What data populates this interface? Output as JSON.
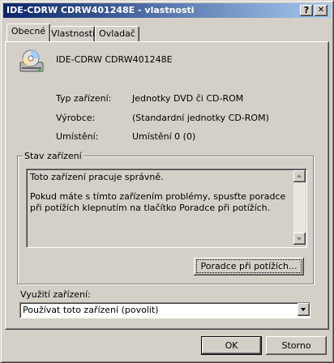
{
  "window": {
    "title": "IDE-CDRW CDRW401248E - vlastnosti",
    "help_label": "?",
    "close_label": "✕"
  },
  "tabs": [
    {
      "label": "Obecné",
      "active": true
    },
    {
      "label": "Vlastnosti",
      "active": false
    },
    {
      "label": "Ovladač",
      "active": false
    }
  ],
  "device": {
    "name": "IDE-CDRW CDRW401248E",
    "icon": "cd-drive-icon"
  },
  "properties": [
    {
      "label": "Typ zařízení:",
      "value": "Jednotky DVD či CD-ROM"
    },
    {
      "label": "Výrobce:",
      "value": "(Standardní jednotky CD-ROM)"
    },
    {
      "label": "Umístění:",
      "value": "Umístění 0 (0)"
    }
  ],
  "status_group": {
    "title": "Stav zařízení",
    "line1": "Toto zařízení pracuje správně.",
    "line2": "Pokud máte s tímto zařízením problémy, spusťte poradce při potížích klepnutím na tlačítko Poradce při potížích.",
    "troubleshoot_button": "Poradce při potížích..."
  },
  "usage": {
    "label": "Využití zařízení:",
    "selected": "Používat toto zařízení (povolit)"
  },
  "buttons": {
    "ok": "OK",
    "cancel": "Storno"
  }
}
